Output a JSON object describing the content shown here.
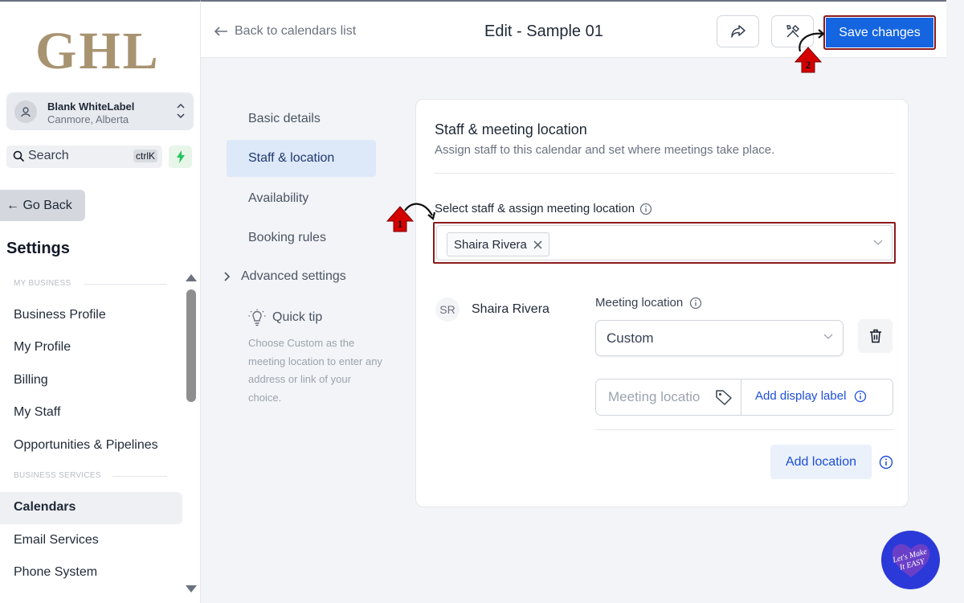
{
  "sidebar": {
    "logo": "GHL",
    "account": {
      "name": "Blank WhiteLabel",
      "location": "Canmore, Alberta"
    },
    "search": {
      "label": "Search",
      "shortcut": "ctrlK"
    },
    "go_back": "← Go Back",
    "title": "Settings",
    "sections": [
      {
        "label": "MY BUSINESS",
        "items": [
          "Business Profile",
          "My Profile",
          "Billing",
          "My Staff",
          "Opportunities & Pipelines"
        ]
      },
      {
        "label": "BUSINESS SERVICES",
        "items": [
          "Calendars",
          "Email Services",
          "Phone System"
        ]
      }
    ],
    "active_item": "Calendars"
  },
  "header": {
    "back_label": "Back to calendars list",
    "title": "Edit - Sample 01",
    "save_label": "Save changes"
  },
  "steps": {
    "items": [
      "Basic details",
      "Staff & location",
      "Availability",
      "Booking rules"
    ],
    "active": "Staff & location",
    "advanced": "Advanced settings",
    "tip_title": "Quick tip",
    "tip_text": "Choose Custom as the meeting location to enter any address or link of your choice."
  },
  "card": {
    "title": "Staff & meeting location",
    "subtitle": "Assign staff to this calendar and set where meetings take place.",
    "select_label": "Select staff & assign meeting location",
    "selected_chip": "Shaira Rivera",
    "staff": {
      "initials": "SR",
      "name": "Shaira Rivera",
      "meeting_location_label": "Meeting location",
      "meeting_location_value": "Custom",
      "location_placeholder": "Meeting locatio",
      "add_display_label": "Add display label",
      "add_location": "Add location"
    }
  },
  "annotations": {
    "step1": "1",
    "step2": "2",
    "badge_text": "Let's Make It EASY"
  },
  "colors": {
    "primary": "#1565e0",
    "highlight": "#8b1a1a",
    "marker": "#d40000"
  }
}
